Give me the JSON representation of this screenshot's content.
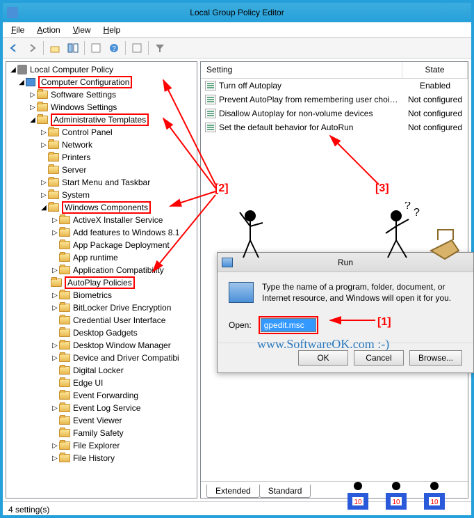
{
  "window": {
    "title": "Local Group Policy Editor"
  },
  "menubar": {
    "file": "File",
    "action": "Action",
    "view": "View",
    "help": "Help"
  },
  "tree": {
    "root": "Local Computer Policy",
    "computer_config": "Computer Configuration",
    "software_settings": "Software Settings",
    "windows_settings": "Windows Settings",
    "admin_templates": "Administrative Templates",
    "control_panel": "Control Panel",
    "network": "Network",
    "printers": "Printers",
    "server": "Server",
    "start_menu": "Start Menu and Taskbar",
    "system": "System",
    "windows_components": "Windows Components",
    "items": [
      "ActiveX Installer Service",
      "Add features to Windows 8.1",
      "App Package Deployment",
      "App runtime",
      "Application Compatibility",
      "AutoPlay Policies",
      "Biometrics",
      "BitLocker Drive Encryption",
      "Credential User Interface",
      "Desktop Gadgets",
      "Desktop Window Manager",
      "Device and Driver Compatibi",
      "Digital Locker",
      "Edge UI",
      "Event Forwarding",
      "Event Log Service",
      "Event Viewer",
      "Family Safety",
      "File Explorer",
      "File History"
    ]
  },
  "list": {
    "header_setting": "Setting",
    "header_state": "State",
    "rows": [
      {
        "setting": "Turn off Autoplay",
        "state": "Enabled"
      },
      {
        "setting": "Prevent AutoPlay from remembering user choic...",
        "state": "Not configured"
      },
      {
        "setting": "Disallow Autoplay for non-volume devices",
        "state": "Not configured"
      },
      {
        "setting": "Set the default behavior for AutoRun",
        "state": "Not configured"
      }
    ]
  },
  "tabs": {
    "extended": "Extended",
    "standard": "Standard"
  },
  "statusbar": {
    "text": "4 setting(s)"
  },
  "run": {
    "title": "Run",
    "desc": "Type the name of a program, folder, document, or Internet resource, and Windows will open it for you.",
    "open_label": "Open:",
    "open_value": "gpedit.msc",
    "ok": "OK",
    "cancel": "Cancel",
    "browse": "Browse..."
  },
  "annotations": {
    "a1": "[1]",
    "a2": "[2]",
    "a3": "[3]"
  },
  "watermark": "www.SoftwareOK.com :-)"
}
